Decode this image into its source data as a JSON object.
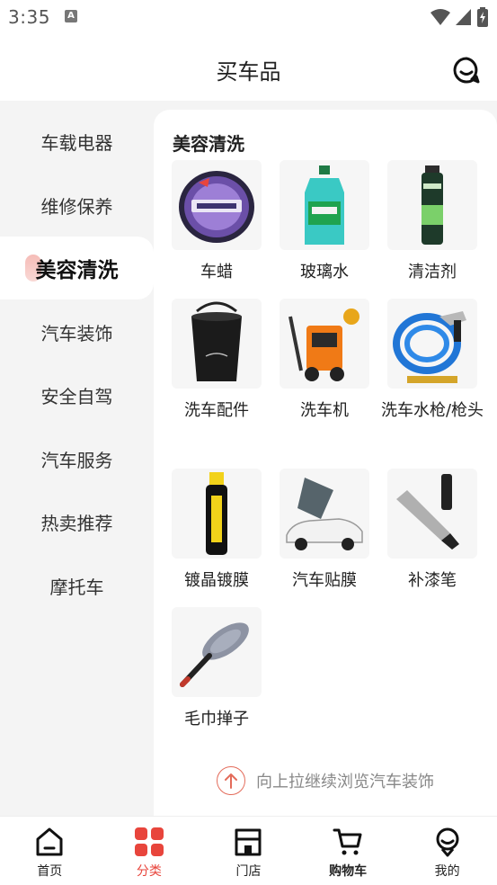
{
  "status_bar": {
    "time": "3:35",
    "notification_letter": "A"
  },
  "header": {
    "title": "买车品"
  },
  "sidebar": {
    "items": [
      {
        "label": "车载电器"
      },
      {
        "label": "维修保养"
      },
      {
        "label": "美容清洗",
        "active": true
      },
      {
        "label": "汽车装饰"
      },
      {
        "label": "安全自驾"
      },
      {
        "label": "汽车服务"
      },
      {
        "label": "热卖推荐"
      },
      {
        "label": "摩托车"
      }
    ]
  },
  "main": {
    "section_title": "美容清洗",
    "products": [
      {
        "label": "车蜡",
        "icon": "car-wax-tin-icon"
      },
      {
        "label": "玻璃水",
        "icon": "washer-fluid-bottle-icon"
      },
      {
        "label": "清洁剂",
        "icon": "cleaner-spray-can-icon"
      },
      {
        "label": "洗车配件",
        "icon": "folding-bucket-icon"
      },
      {
        "label": "洗车机",
        "icon": "pressure-washer-icon"
      },
      {
        "label": "洗车水枪/枪头",
        "icon": "hose-spray-gun-icon"
      },
      {
        "label": "镀晶镀膜",
        "icon": "coating-bottle-icon"
      },
      {
        "label": "汽车贴膜",
        "icon": "window-film-car-icon"
      },
      {
        "label": "补漆笔",
        "icon": "touch-up-pen-icon"
      },
      {
        "label": "毛巾掸子",
        "icon": "duster-icon"
      }
    ],
    "hint_text": "向上拉继续浏览汽车装饰"
  },
  "bottom_nav": {
    "items": [
      {
        "label": "首页",
        "icon": "home-icon"
      },
      {
        "label": "分类",
        "icon": "category-grid-icon",
        "active": true
      },
      {
        "label": "门店",
        "icon": "store-icon"
      },
      {
        "label": "购物车",
        "icon": "cart-icon"
      },
      {
        "label": "我的",
        "icon": "profile-icon"
      }
    ]
  },
  "colors": {
    "accent": "#e8453c",
    "sidebar_bg": "#f4f4f4"
  }
}
